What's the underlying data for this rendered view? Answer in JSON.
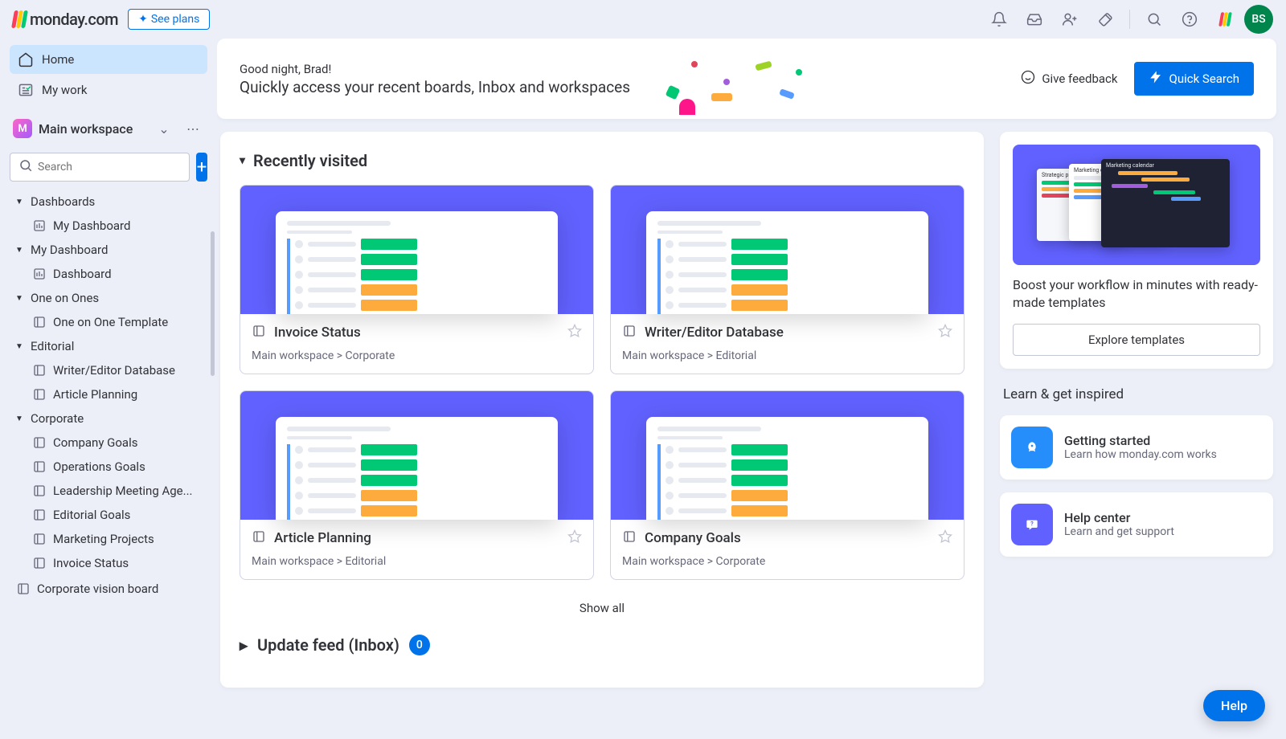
{
  "header": {
    "brand": "monday.com",
    "see_plans": "See plans",
    "avatar_initials": "BS"
  },
  "sidebar": {
    "home": "Home",
    "my_work": "My work",
    "workspace_name": "Main workspace",
    "search_placeholder": "Search",
    "groups": [
      {
        "name": "Dashboards",
        "items": [
          "My Dashboard"
        ]
      },
      {
        "name": "My Dashboard",
        "items": [
          "Dashboard"
        ]
      },
      {
        "name": "One on Ones",
        "items": [
          "One on One Template"
        ]
      },
      {
        "name": "Editorial",
        "items": [
          "Writer/Editor Database",
          "Article Planning"
        ]
      },
      {
        "name": "Corporate",
        "items": [
          "Company Goals",
          "Operations Goals",
          "Leadership Meeting Age...",
          "Editorial Goals",
          "Marketing Projects",
          "Invoice Status"
        ]
      }
    ],
    "bottom_item": "Corporate vision board"
  },
  "hero": {
    "greeting": "Good night, Brad!",
    "sub": "Quickly access your recent boards, Inbox and workspaces",
    "feedback": "Give feedback",
    "quick_search": "Quick Search"
  },
  "recent": {
    "title": "Recently visited",
    "cards": [
      {
        "title": "Invoice Status",
        "path": "Main workspace  >  Corporate"
      },
      {
        "title": "Writer/Editor Database",
        "path": "Main workspace  >  Editorial"
      },
      {
        "title": "Article Planning",
        "path": "Main workspace  >  Editorial"
      },
      {
        "title": "Company Goals",
        "path": "Main workspace  >  Corporate"
      }
    ],
    "show_all": "Show all"
  },
  "update_feed": {
    "title": "Update feed (Inbox)",
    "count": "0"
  },
  "side": {
    "templates_text": "Boost your workflow in minutes with ready-made templates",
    "explore": "Explore templates",
    "learn_heading": "Learn & get inspired",
    "getting_started": {
      "title": "Getting started",
      "sub": "Learn how monday.com works"
    },
    "help_center": {
      "title": "Help center",
      "sub": "Learn and get support"
    }
  },
  "help_button": "Help"
}
